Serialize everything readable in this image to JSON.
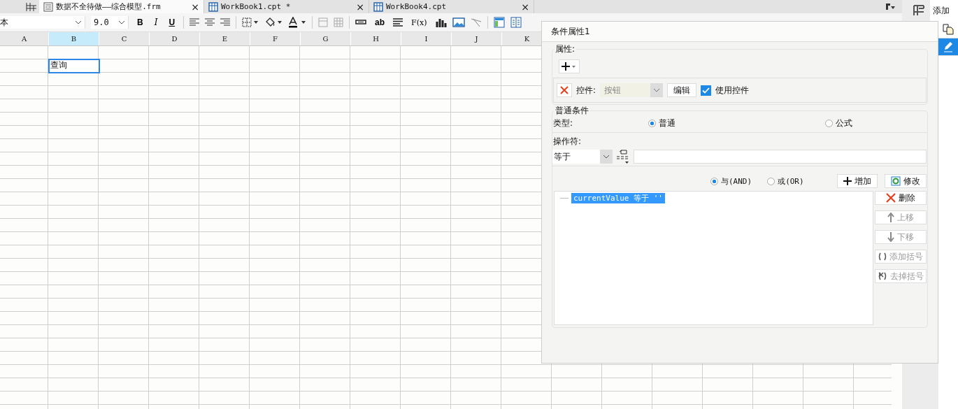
{
  "tabs": [
    {
      "label": "数据不全待做——综合模型.frm",
      "kind": "form",
      "selected": true,
      "close": "×"
    },
    {
      "label": "WorkBook1.cpt *",
      "kind": "book",
      "selected": false,
      "close": "×"
    },
    {
      "label": "WorkBook4.cpt",
      "kind": "book",
      "selected": false,
      "close": "×"
    }
  ],
  "toolbar": {
    "font": "本",
    "size": "9.0",
    "bold": "B",
    "italic": "I",
    "underline": "U",
    "text_tool": "ab",
    "formula_tool": "F(x)"
  },
  "sheet": {
    "columns": [
      {
        "label": "A",
        "selected": false
      },
      {
        "label": "B",
        "selected": true
      },
      {
        "label": "C",
        "selected": false
      },
      {
        "label": "D",
        "selected": false
      },
      {
        "label": "E",
        "selected": false
      },
      {
        "label": "F",
        "selected": false
      },
      {
        "label": "G",
        "selected": false
      },
      {
        "label": "H",
        "selected": false
      },
      {
        "label": "I",
        "selected": false
      },
      {
        "label": "J",
        "selected": false
      },
      {
        "label": "K",
        "selected": false
      }
    ],
    "active_cell": {
      "text": "查询",
      "selected": true
    }
  },
  "right_panel": {
    "title": "添加",
    "tools": [
      {
        "kind": "copy",
        "selected": false
      },
      {
        "kind": "edit",
        "selected": true
      }
    ]
  },
  "dialog": {
    "title": "条件属性1",
    "attributes": {
      "legend": "属性:",
      "widget_label": "控件:",
      "widget_value": "按钮",
      "edit_button": "编辑",
      "use_widget": {
        "label": "使用控件",
        "checked": true
      }
    },
    "conditions": {
      "legend": "普通条件",
      "type_label": "类型:",
      "types": [
        {
          "label": "普通",
          "selected": true
        },
        {
          "label": "公式",
          "selected": false
        }
      ],
      "operator_label": "操作符:",
      "operator": "等于",
      "joins": [
        {
          "label": "与(AND)",
          "selected": true
        },
        {
          "label": "或(OR)",
          "selected": false
        }
      ],
      "add_button": "增加",
      "modify_button": "修改",
      "items": [
        {
          "text": "currentValue 等于 ''",
          "selected": true
        }
      ],
      "side_buttons": [
        {
          "kind": "delete",
          "label": "删除",
          "disabled": false
        },
        {
          "kind": "up",
          "label": "上移",
          "disabled": true
        },
        {
          "kind": "down",
          "label": "下移",
          "disabled": true
        },
        {
          "kind": "add-bracket",
          "label": "添加括号",
          "disabled": true
        },
        {
          "kind": "remove-bracket",
          "label": "去掉括号",
          "disabled": true
        }
      ]
    }
  }
}
